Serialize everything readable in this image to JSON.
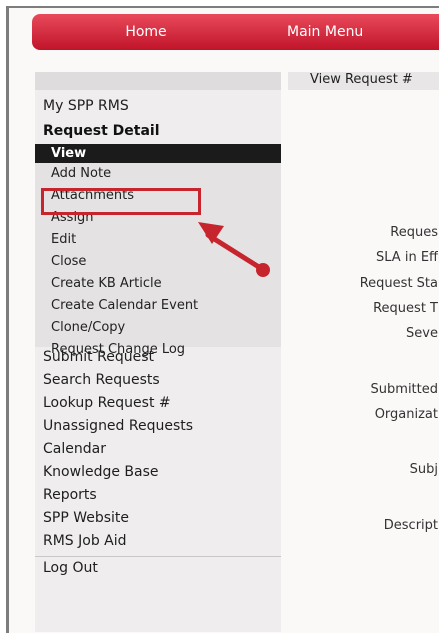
{
  "topnav": {
    "home": "Home",
    "main_menu": "Main Menu"
  },
  "sidebar": {
    "my_rms": "My SPP RMS",
    "request_detail": "Request Detail",
    "sub_items": [
      "View",
      "Add Note",
      "Attachments",
      "Assign",
      "Edit",
      "Close",
      "Create KB Article",
      "Create Calendar Event",
      "Clone/Copy",
      "Request Change Log"
    ],
    "active_item": "View",
    "highlighted_item": "Attachments",
    "items": [
      "Submit Request",
      "Search Requests",
      "Lookup Request #",
      "Unassigned Requests",
      "Calendar",
      "Knowledge Base",
      "Reports",
      "SPP Website",
      "RMS Job Aid",
      "Log Out"
    ]
  },
  "main": {
    "title": "View Request #",
    "labels": [
      "Reques",
      "SLA in Eff",
      "Request Sta",
      "Request T",
      "Seve",
      "Submitted",
      "Organizat",
      "Subj",
      "Descript"
    ]
  },
  "annotation": {
    "highlight_color": "#c7252e"
  }
}
